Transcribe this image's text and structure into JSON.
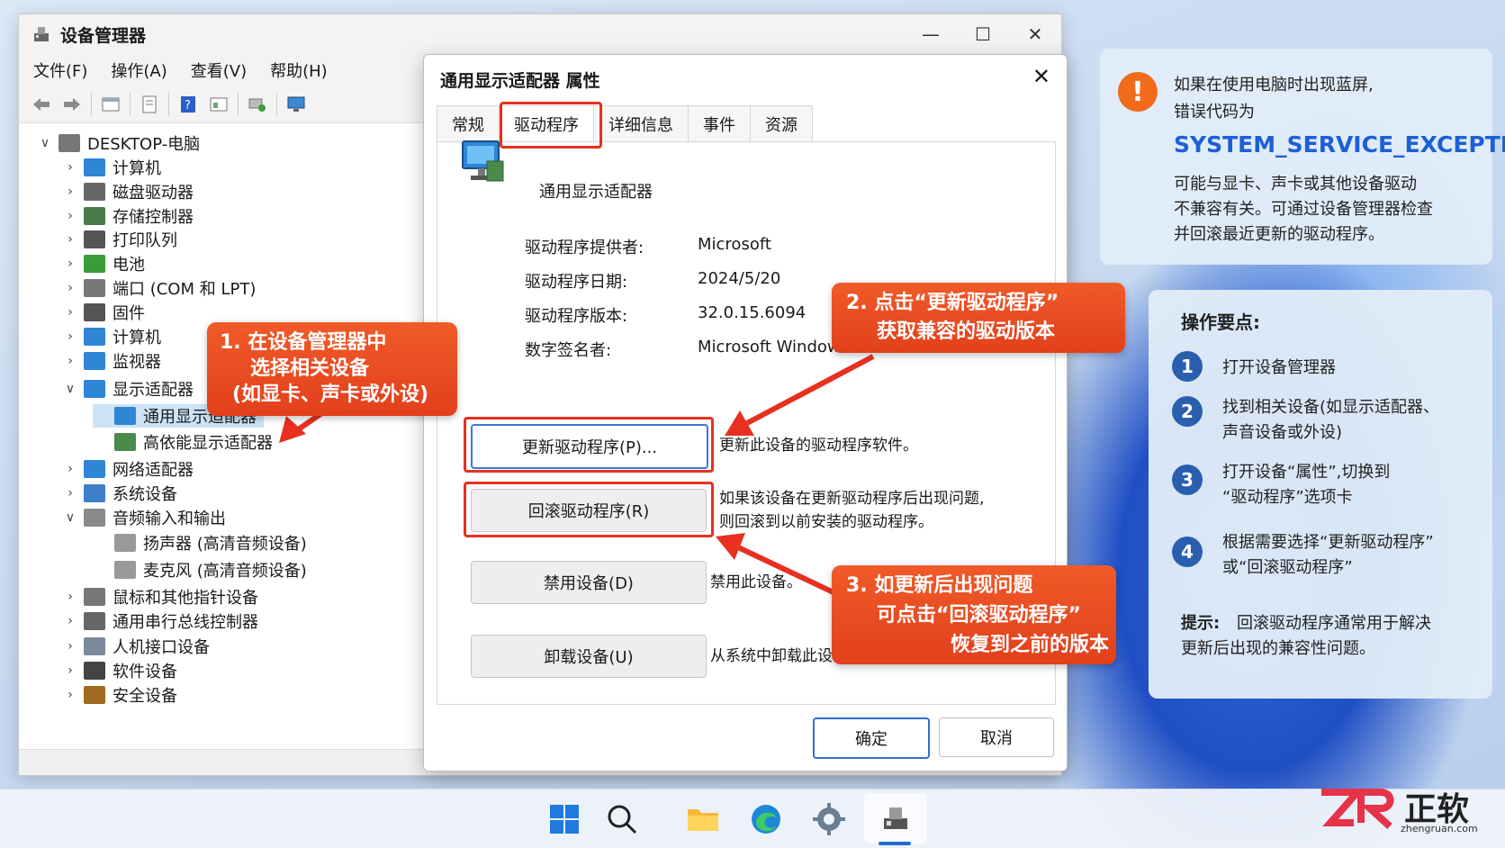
{
  "device_manager": {
    "title": "设备管理器",
    "menu": [
      "文件(F)",
      "操作(A)",
      "查看(V)",
      "帮助(H)"
    ],
    "tree": [
      {
        "label": "DESKTOP-电脑",
        "chev": "∨"
      },
      {
        "label": "计算机",
        "chev": "›"
      },
      {
        "label": "磁盘驱动器",
        "chev": "›"
      },
      {
        "label": "存储控制器",
        "chev": "›"
      },
      {
        "label": "打印队列",
        "chev": "›"
      },
      {
        "label": "电池",
        "chev": "›"
      },
      {
        "label": "端口 (COM 和 LPT)",
        "chev": "›"
      },
      {
        "label": "固件",
        "chev": "›"
      },
      {
        "label": "计算机",
        "chev": "›"
      },
      {
        "label": "监视器",
        "chev": "›"
      },
      {
        "label": "显示适配器",
        "chev": "∨"
      },
      {
        "label": "通用显示适配器",
        "chev": ""
      },
      {
        "label": "高依能显示适配器",
        "chev": ""
      },
      {
        "label": "网络适配器",
        "chev": "›"
      },
      {
        "label": "系统设备",
        "chev": "›"
      },
      {
        "label": "音频输入和输出",
        "chev": "∨"
      },
      {
        "label": "扬声器 (高清音频设备)",
        "chev": ""
      },
      {
        "label": "麦克风 (高清音频设备)",
        "chev": ""
      },
      {
        "label": "鼠标和其他指针设备",
        "chev": "›"
      },
      {
        "label": "通用串行总线控制器",
        "chev": "›"
      },
      {
        "label": "人机接口设备",
        "chev": "›"
      },
      {
        "label": "软件设备",
        "chev": "›"
      },
      {
        "label": "安全设备",
        "chev": "›"
      }
    ]
  },
  "dialog": {
    "title": "通用显示适配器  属性",
    "tabs": [
      "常规",
      "驱动程序",
      "详细信息",
      "事件",
      "资源"
    ],
    "device_name": "通用显示适配器",
    "info": [
      {
        "label": "驱动程序提供者:",
        "value": "Microsoft"
      },
      {
        "label": "驱动程序日期:",
        "value": "2024/5/20"
      },
      {
        "label": "驱动程序版本:",
        "value": "32.0.15.6094"
      },
      {
        "label": "数字签名者:",
        "value": "Microsoft Windows"
      }
    ],
    "actions": [
      {
        "label": "更新驱动程序(P)...",
        "desc": [
          "更新此设备的驱动程序软件。"
        ]
      },
      {
        "label": "回滚驱动程序(R)",
        "desc": [
          "如果该设备在更新驱动程序后出现问题,",
          "则回滚到以前安装的驱动程序。"
        ]
      },
      {
        "label": "禁用设备(D)",
        "desc": [
          "禁用此设备。"
        ]
      },
      {
        "label": "卸载设备(U)",
        "desc": [
          "从系统中卸载此设备(高级)。"
        ]
      }
    ],
    "ok": "确定",
    "cancel": "取消"
  },
  "callouts": {
    "c1": [
      "1. 在设备管理器中",
      "选择相关设备",
      "(如显卡、声卡或外设)"
    ],
    "c2": [
      "2. 点击“更新驱动程序”",
      "获取兼容的驱动版本"
    ],
    "c3": [
      "3. 如更新后出现问题",
      "可点击“回滚驱动程序”",
      "恢复到之前的版本"
    ]
  },
  "warning_panel": {
    "line1": "如果在使用电脑时出现蓝屏,",
    "line2": "错误代码为",
    "code": "SYSTEM_SERVICE_EXCEPTION",
    "desc": [
      "可能与显卡、声卡或其他设备驱动",
      "不兼容有关。可通过设备管理器检查",
      "并回滚最近更新的驱动程序。"
    ]
  },
  "steps_panel": {
    "title": "操作要点:",
    "steps": [
      {
        "num": "1",
        "lines": [
          "打开设备管理器"
        ]
      },
      {
        "num": "2",
        "lines": [
          "找到相关设备(如显示适配器、",
          "声音设备或外设)"
        ]
      },
      {
        "num": "3",
        "lines": [
          "打开设备“属性”,切换到",
          "“驱动程序”选项卡"
        ]
      },
      {
        "num": "4",
        "lines": [
          "根据需要选择“更新驱动程序”",
          "或“回滚驱动程序”"
        ]
      }
    ],
    "tip_label": "提示:",
    "tip_line1": "回滚驱动程序通常用于解决",
    "tip_line2": "更新后出现的兼容性问题。"
  },
  "brand": {
    "name": "正软",
    "url": "zhengruan.com"
  },
  "colors": {
    "accent_red": "#e8301f",
    "callout_orange": "#f05a28",
    "code_blue": "#1d5fd6",
    "step_blue": "#2a5fae"
  }
}
